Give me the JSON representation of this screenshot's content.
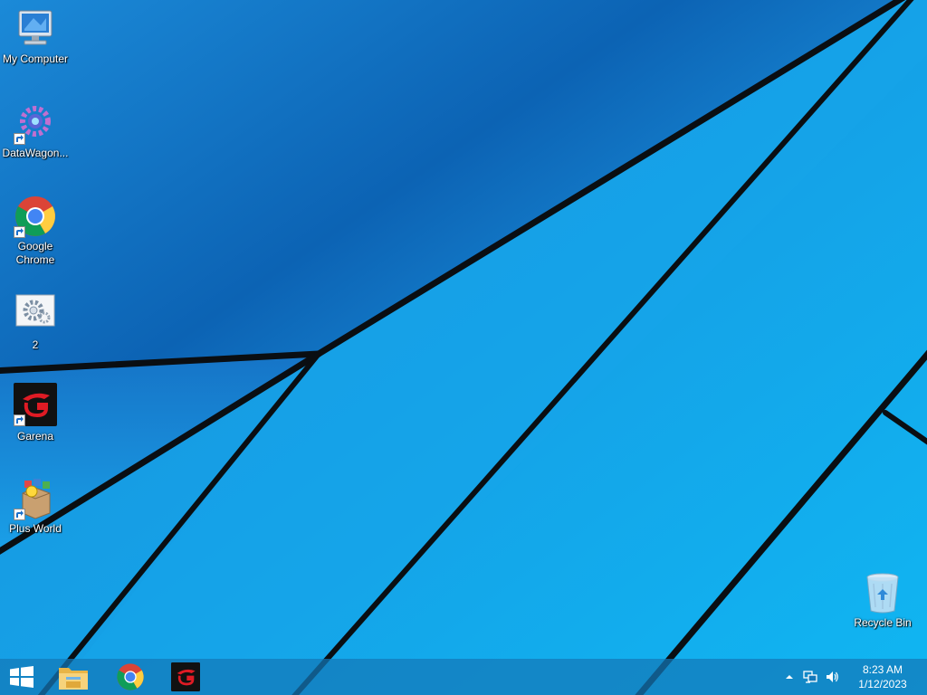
{
  "desktop": {
    "icons": [
      {
        "label": "My Computer",
        "icon": "computer-icon"
      },
      {
        "label": "DataWagon...",
        "icon": "datawagon-icon"
      },
      {
        "label": "Google Chrome",
        "icon": "chrome-icon"
      },
      {
        "label": "2",
        "icon": "settings-file-icon"
      },
      {
        "label": "Garena",
        "icon": "garena-icon"
      },
      {
        "label": "Plus World",
        "icon": "plus-world-icon"
      },
      {
        "label": "Recycle Bin",
        "icon": "recycle-bin-icon"
      }
    ]
  },
  "taskbar": {
    "pinned": [
      {
        "icon": "windows-start-icon"
      },
      {
        "icon": "file-explorer-icon"
      },
      {
        "icon": "chrome-icon"
      },
      {
        "icon": "garena-icon"
      }
    ],
    "tray": {
      "icons": [
        "chevron-up-icon",
        "network-icon",
        "volume-icon"
      ],
      "time": "8:23 AM",
      "date": "1/12/2023"
    }
  },
  "colors": {
    "wallpaper_light": "#1aa7ec",
    "wallpaper_dark": "#0b5fb0",
    "taskbar": "#1478b9"
  }
}
